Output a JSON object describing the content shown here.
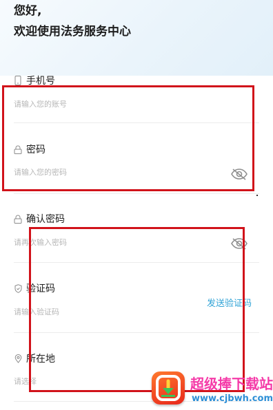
{
  "header": {
    "greeting_line1": "您好,",
    "greeting_line2": "欢迎使用法务服务中心"
  },
  "fields": {
    "phone": {
      "label": "手机号",
      "placeholder": "请输入您的账号"
    },
    "password": {
      "label": "密码",
      "placeholder": "请输入您的密码"
    },
    "confirm_password": {
      "label": "确认密码",
      "placeholder": "请再次输入密码"
    },
    "verification": {
      "label": "验证码",
      "placeholder": "请输入验证码",
      "send_label": "发送验证码"
    },
    "location": {
      "label": "所在地",
      "placeholder": "请选择"
    }
  },
  "icons": {
    "phone": "phone-icon",
    "lock": "lock-icon",
    "shield": "shield-icon",
    "location": "location-pin-icon",
    "password_toggle": "eye-off-icon"
  },
  "colors": {
    "accent": "#31a3d6",
    "annotation_box": "#d1121a",
    "placeholder": "#b7b7b7"
  },
  "watermark": {
    "brand": "超级捧下载站",
    "url": "www.cjbwh.com"
  }
}
